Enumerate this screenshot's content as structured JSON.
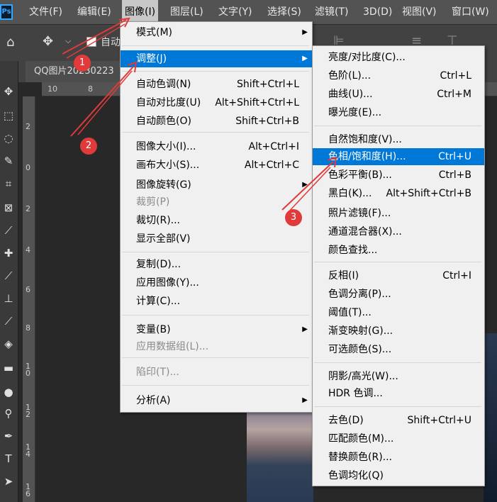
{
  "menubar": {
    "logo": "Ps",
    "items": [
      "文件(F)",
      "编辑(E)",
      "图像(I)",
      "图层(L)",
      "文字(Y)",
      "选择(S)",
      "滤镜(T)",
      "3D(D)",
      "视图(V)",
      "窗口(W)"
    ]
  },
  "options": {
    "auto_label": "自动"
  },
  "tab": {
    "title": "QQ图片20230223"
  },
  "ruler_h": [
    "10",
    "8"
  ],
  "ruler_v": [
    "2",
    "0",
    "2",
    "4",
    "6",
    "8",
    "1\n0",
    "1\n2",
    "1\n4",
    "1\n6"
  ],
  "image_menu": [
    {
      "label": "模式(M)",
      "shortcut": "",
      "sub": true
    },
    {
      "label": "调整(J)",
      "shortcut": "",
      "sub": true,
      "hl": true
    },
    {
      "label": "自动色调(N)",
      "shortcut": "Shift+Ctrl+L"
    },
    {
      "label": "自动对比度(U)",
      "shortcut": "Alt+Shift+Ctrl+L"
    },
    {
      "label": "自动颜色(O)",
      "shortcut": "Shift+Ctrl+B"
    },
    {
      "label": "图像大小(I)...",
      "shortcut": "Alt+Ctrl+I"
    },
    {
      "label": "画布大小(S)...",
      "shortcut": "Alt+Ctrl+C"
    },
    {
      "label": "图像旋转(G)",
      "shortcut": "",
      "sub": true
    },
    {
      "label": "裁剪(P)",
      "shortcut": "",
      "disabled": true
    },
    {
      "label": "裁切(R)...",
      "shortcut": ""
    },
    {
      "label": "显示全部(V)",
      "shortcut": ""
    },
    {
      "label": "复制(D)...",
      "shortcut": ""
    },
    {
      "label": "应用图像(Y)...",
      "shortcut": ""
    },
    {
      "label": "计算(C)...",
      "shortcut": ""
    },
    {
      "label": "变量(B)",
      "shortcut": "",
      "sub": true
    },
    {
      "label": "应用数据组(L)...",
      "shortcut": "",
      "disabled": true
    },
    {
      "label": "陷印(T)...",
      "shortcut": "",
      "disabled": true
    },
    {
      "label": "分析(A)",
      "shortcut": "",
      "sub": true
    }
  ],
  "adjust_menu": [
    {
      "label": "亮度/对比度(C)...",
      "shortcut": ""
    },
    {
      "label": "色阶(L)...",
      "shortcut": "Ctrl+L"
    },
    {
      "label": "曲线(U)...",
      "shortcut": "Ctrl+M"
    },
    {
      "label": "曝光度(E)...",
      "shortcut": ""
    },
    {
      "label": "自然饱和度(V)...",
      "shortcut": ""
    },
    {
      "label": "色相/饱和度(H)...",
      "shortcut": "Ctrl+U",
      "hl": true
    },
    {
      "label": "色彩平衡(B)...",
      "shortcut": "Ctrl+B"
    },
    {
      "label": "黑白(K)...",
      "shortcut": "Alt+Shift+Ctrl+B"
    },
    {
      "label": "照片滤镜(F)...",
      "shortcut": ""
    },
    {
      "label": "通道混合器(X)...",
      "shortcut": ""
    },
    {
      "label": "颜色查找...",
      "shortcut": ""
    },
    {
      "label": "反相(I)",
      "shortcut": "Ctrl+I"
    },
    {
      "label": "色调分离(P)...",
      "shortcut": ""
    },
    {
      "label": "阈值(T)...",
      "shortcut": ""
    },
    {
      "label": "渐变映射(G)...",
      "shortcut": ""
    },
    {
      "label": "可选颜色(S)...",
      "shortcut": ""
    },
    {
      "label": "阴影/高光(W)...",
      "shortcut": ""
    },
    {
      "label": "HDR 色调...",
      "shortcut": ""
    },
    {
      "label": "去色(D)",
      "shortcut": "Shift+Ctrl+U"
    },
    {
      "label": "匹配颜色(M)...",
      "shortcut": ""
    },
    {
      "label": "替换颜色(R)...",
      "shortcut": ""
    },
    {
      "label": "色调均化(Q)",
      "shortcut": ""
    }
  ],
  "badges": [
    "1",
    "2",
    "3"
  ],
  "colors": {
    "accent": "#0078d7",
    "badge": "#e03a3a"
  }
}
